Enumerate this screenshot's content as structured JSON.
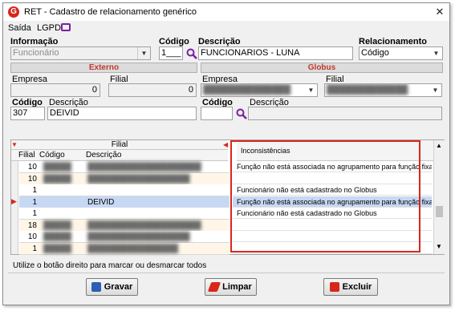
{
  "window": {
    "title": "RET - Cadastro de relacionamento genérico",
    "close": "✕"
  },
  "menu": [
    {
      "label": "Saída"
    },
    {
      "label": "LGPD"
    }
  ],
  "form": {
    "informacao_label": "Informação",
    "informacao_value": "Funcionário",
    "codigo_label": "Código",
    "codigo_value": "1___",
    "descricao_label": "Descrição",
    "descricao_value": "FUNCIONARIOS - LUNA",
    "relacionamento_label": "Relacionamento",
    "relacionamento_value": "Código"
  },
  "externo": {
    "title": "Externo",
    "empresa_label": "Empresa",
    "empresa_value": "0",
    "filial_label": "Filial",
    "filial_value": "0",
    "codigo_label": "Código",
    "codigo_value": "307",
    "descricao_label": "Descrição",
    "descricao_value": "DEIVID"
  },
  "globus": {
    "title": "Globus",
    "empresa_label": "Empresa",
    "filial_label": "Filial",
    "codigo_label": "Código",
    "descricao_label": "Descrição"
  },
  "grid": {
    "group_header": "Filial",
    "columns": [
      "Filial",
      "Código",
      "Descrição"
    ],
    "rows": [
      {
        "filial": "10",
        "codigo": "█████",
        "descricao": "████████████████████",
        "selected": false
      },
      {
        "filial": "10",
        "codigo": "█████",
        "descricao": "██████████████████",
        "selected": false
      },
      {
        "filial": "1",
        "codigo": "",
        "descricao": "",
        "selected": false
      },
      {
        "filial": "1",
        "codigo": "",
        "descricao": "DEIVID",
        "selected": true
      },
      {
        "filial": "1",
        "codigo": "",
        "descricao": "",
        "selected": false
      },
      {
        "filial": "18",
        "codigo": "█████",
        "descricao": "████████████████████",
        "selected": false
      },
      {
        "filial": "10",
        "codigo": "█████",
        "descricao": "██████████████████",
        "selected": false
      },
      {
        "filial": "1",
        "codigo": "█████",
        "descricao": "████████████████",
        "selected": false
      }
    ],
    "inconsistencias_header": "Inconsistências",
    "inconsistencias": [
      "Função não está associada no agrupamento para função fixa",
      "",
      "Funcionário não está cadastrado no Globus",
      "Função não está associada no agrupamento para função fixa",
      "Funcionário não está cadastrado no Globus",
      "",
      "",
      ""
    ]
  },
  "status_text": "Utilize o botão direito para marcar ou desmarcar todos",
  "buttons": {
    "gravar": "Gravar",
    "limpar": "Limpar",
    "excluir": "Excluir"
  },
  "colors": {
    "highlight_border": "#d9261c",
    "selected_row": "#c7d8f3",
    "accent_purple": "#7b1fa2"
  }
}
